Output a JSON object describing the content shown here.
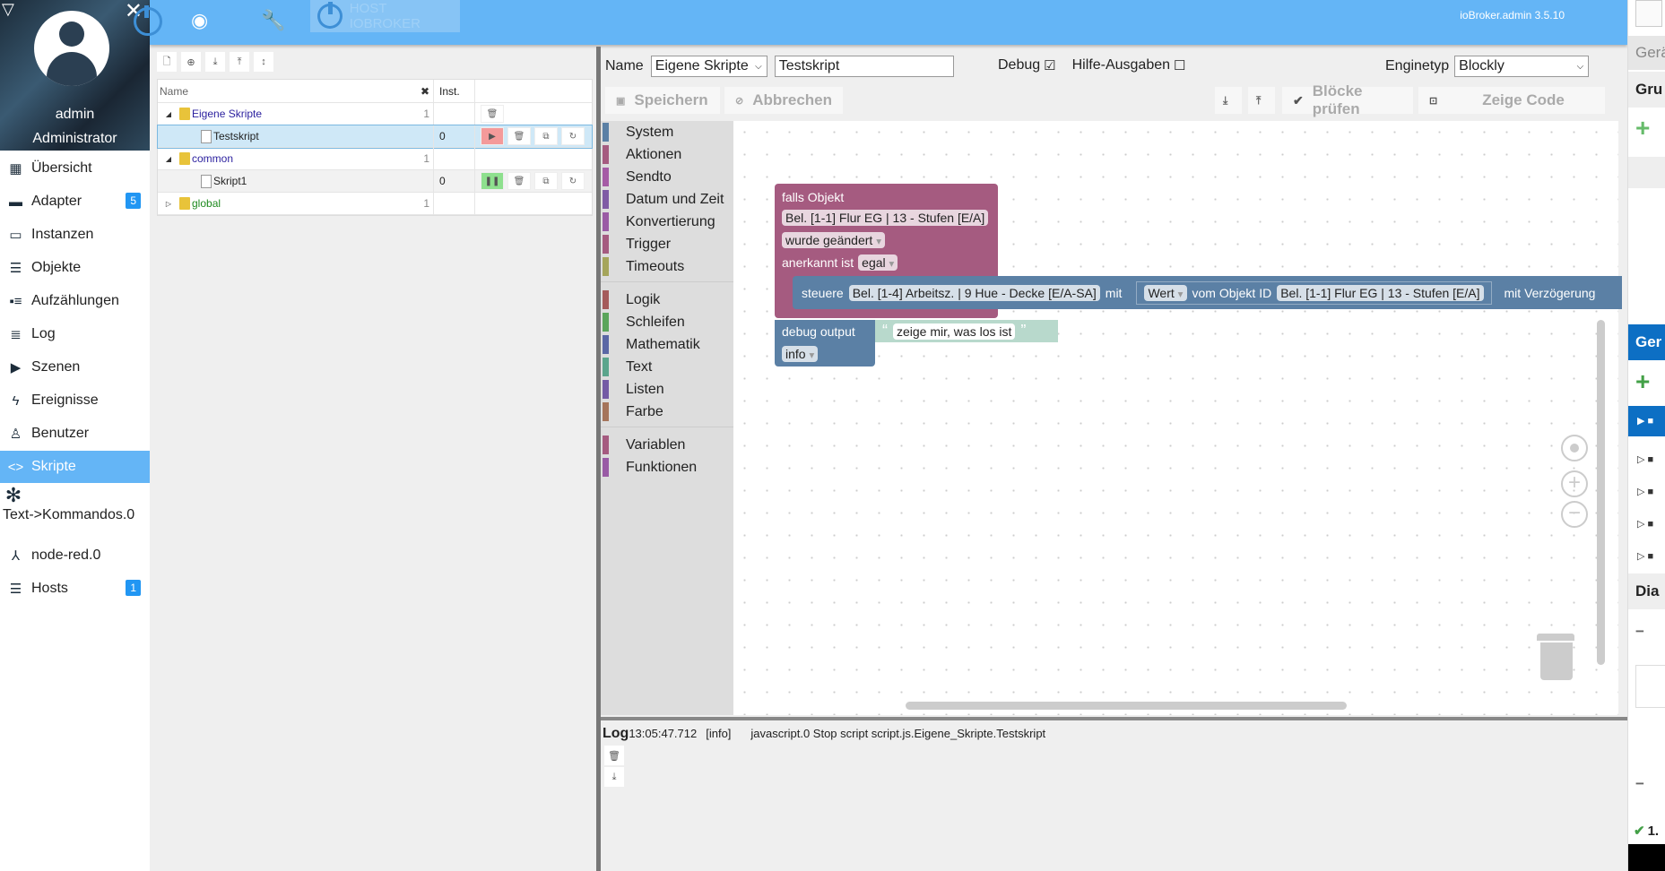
{
  "sidebar": {
    "user": "admin",
    "role": "Administrator",
    "items": [
      {
        "label": "Übersicht",
        "icon": "grid-icon",
        "glyph": "▦"
      },
      {
        "label": "Adapter",
        "icon": "store-icon",
        "glyph": "▬",
        "badge": "5"
      },
      {
        "label": "Instanzen",
        "icon": "instances-icon",
        "glyph": "▭"
      },
      {
        "label": "Objekte",
        "icon": "list-icon",
        "glyph": "☰"
      },
      {
        "label": "Aufzählungen",
        "icon": "enum-icon",
        "glyph": "▪≡"
      },
      {
        "label": "Log",
        "icon": "log-icon",
        "glyph": "≣"
      },
      {
        "label": "Szenen",
        "icon": "scenes-icon",
        "glyph": "▶"
      },
      {
        "label": "Ereignisse",
        "icon": "flash-icon",
        "glyph": "ϟ"
      },
      {
        "label": "Benutzer",
        "icon": "user-icon",
        "glyph": "♙"
      },
      {
        "label": "Skripte",
        "icon": "code-icon",
        "glyph": "<>",
        "active": true
      },
      {
        "label": "Text->Kommandos.0",
        "icon": "snowflake-icon",
        "glyph": "✻"
      },
      {
        "label": "node-red.0",
        "icon": "node-red-icon",
        "glyph": "⅄"
      },
      {
        "label": "Hosts",
        "icon": "hosts-icon",
        "glyph": "☰",
        "badge": "1"
      }
    ]
  },
  "topbar": {
    "host_label": "HOST IOBROKER",
    "version": "ioBroker.admin 3.5.10"
  },
  "tree": {
    "col_name": "Name",
    "col_inst": "Inst.",
    "rows": [
      {
        "name": "Eigene Skripte",
        "type": "folder",
        "count": "1",
        "color": "#2a1f9e"
      },
      {
        "name": "Testskript",
        "type": "script",
        "inst": "0",
        "state": "stopped"
      },
      {
        "name": "common",
        "type": "folder",
        "count": "1",
        "color": "#2a1f9e"
      },
      {
        "name": "Skript1",
        "type": "script",
        "inst": "0",
        "state": "running"
      },
      {
        "name": "global",
        "type": "folder",
        "count": "1",
        "color": "#1e8a1e"
      }
    ]
  },
  "editor": {
    "name_label": "Name",
    "folder": "Eigene Skripte",
    "script_name": "Testskript",
    "debug_label": "Debug",
    "debug_checked": true,
    "help_label": "Hilfe-Ausgaben",
    "help_checked": false,
    "engine_label": "Enginetyp",
    "engine": "Blockly",
    "save": "Speichern",
    "cancel": "Abbrechen",
    "check": "Blöcke prüfen",
    "show_code": "Zeige Code"
  },
  "toolbox": [
    {
      "label": "System",
      "color": "#5b80a5"
    },
    {
      "label": "Aktionen",
      "color": "#a55b80"
    },
    {
      "label": "Sendto",
      "color": "#a55ba5"
    },
    {
      "label": "Datum und Zeit",
      "color": "#805ba5"
    },
    {
      "label": "Konvertierung",
      "color": "#9a5ba5"
    },
    {
      "label": "Trigger",
      "color": "#a55b80"
    },
    {
      "label": "Timeouts",
      "color": "#a5a55b"
    },
    {
      "label": "Logik",
      "color": "#a55b5b"
    },
    {
      "label": "Schleifen",
      "color": "#5ba55b"
    },
    {
      "label": "Mathematik",
      "color": "#5b67a5"
    },
    {
      "label": "Text",
      "color": "#5ba58c"
    },
    {
      "label": "Listen",
      "color": "#745ba5"
    },
    {
      "label": "Farbe",
      "color": "#a5745b"
    },
    {
      "label": "Variablen",
      "color": "#a55b80"
    },
    {
      "label": "Funktionen",
      "color": "#995ba5"
    }
  ],
  "blocks": {
    "trigger": {
      "title": "falls Objekt",
      "object": "Bel. [1-1] Flur EG | 13 - Stufen [E/A]",
      "mode": "wurde geändert",
      "ack_label": "anerkannt ist",
      "ack": "egal",
      "color": "#a55b80"
    },
    "control": {
      "label": "steuere",
      "target": "Bel. [1-4] Arbeitsz. | 9 Hue - Decke [E/A-SA]",
      "with": "mit",
      "value": "Wert",
      "from_label": "vom Objekt ID",
      "source": "Bel. [1-1] Flur EG | 13 - Stufen [E/A]",
      "delay": "mit Verzögerung",
      "color": "#5b80a5"
    },
    "debug": {
      "label": "debug output",
      "text": "zeige mir, was los ist",
      "level": "info",
      "color": "#5b80a5",
      "text_color": "#b8d9cc"
    }
  },
  "log": {
    "title": "Log",
    "time": "13:05:47.712",
    "level": "[info]",
    "message": "javascript.0 Stop script script.js.Eigene_Skripte.Testskript"
  },
  "right_panel": {
    "tab": "Gerä",
    "group": "Gru",
    "devices": "Ger",
    "dia": "Dia",
    "status": "1."
  }
}
